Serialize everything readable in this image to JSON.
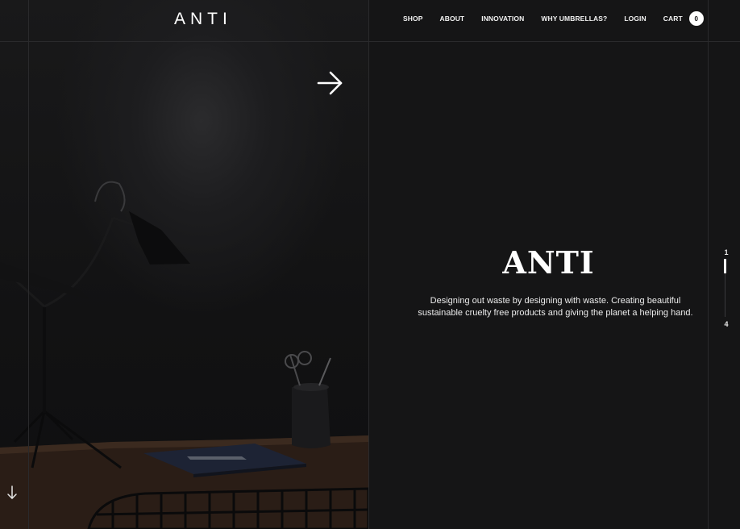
{
  "brand": {
    "logo": "ANTI"
  },
  "nav": {
    "items": [
      {
        "label": "SHOP"
      },
      {
        "label": "ABOUT"
      },
      {
        "label": "INNOVATION"
      },
      {
        "label": "WHY UMBRELLAS?"
      },
      {
        "label": "LOGIN"
      },
      {
        "label": "CART"
      }
    ],
    "cart_count": "0"
  },
  "hero": {
    "title": "ANTI",
    "tagline_line1": "Designing out waste by designing with waste. Creating beautiful",
    "tagline_line2": "sustainable cruelty free products and giving the planet a helping hand."
  },
  "pager": {
    "current": "1",
    "total": "4",
    "progress": 0.25
  },
  "icons": {
    "next": "arrow-right-icon",
    "scroll": "arrow-down-icon"
  },
  "colors": {
    "background": "#151516",
    "text": "#ffffff",
    "grid_line": "#2a2a2c"
  }
}
